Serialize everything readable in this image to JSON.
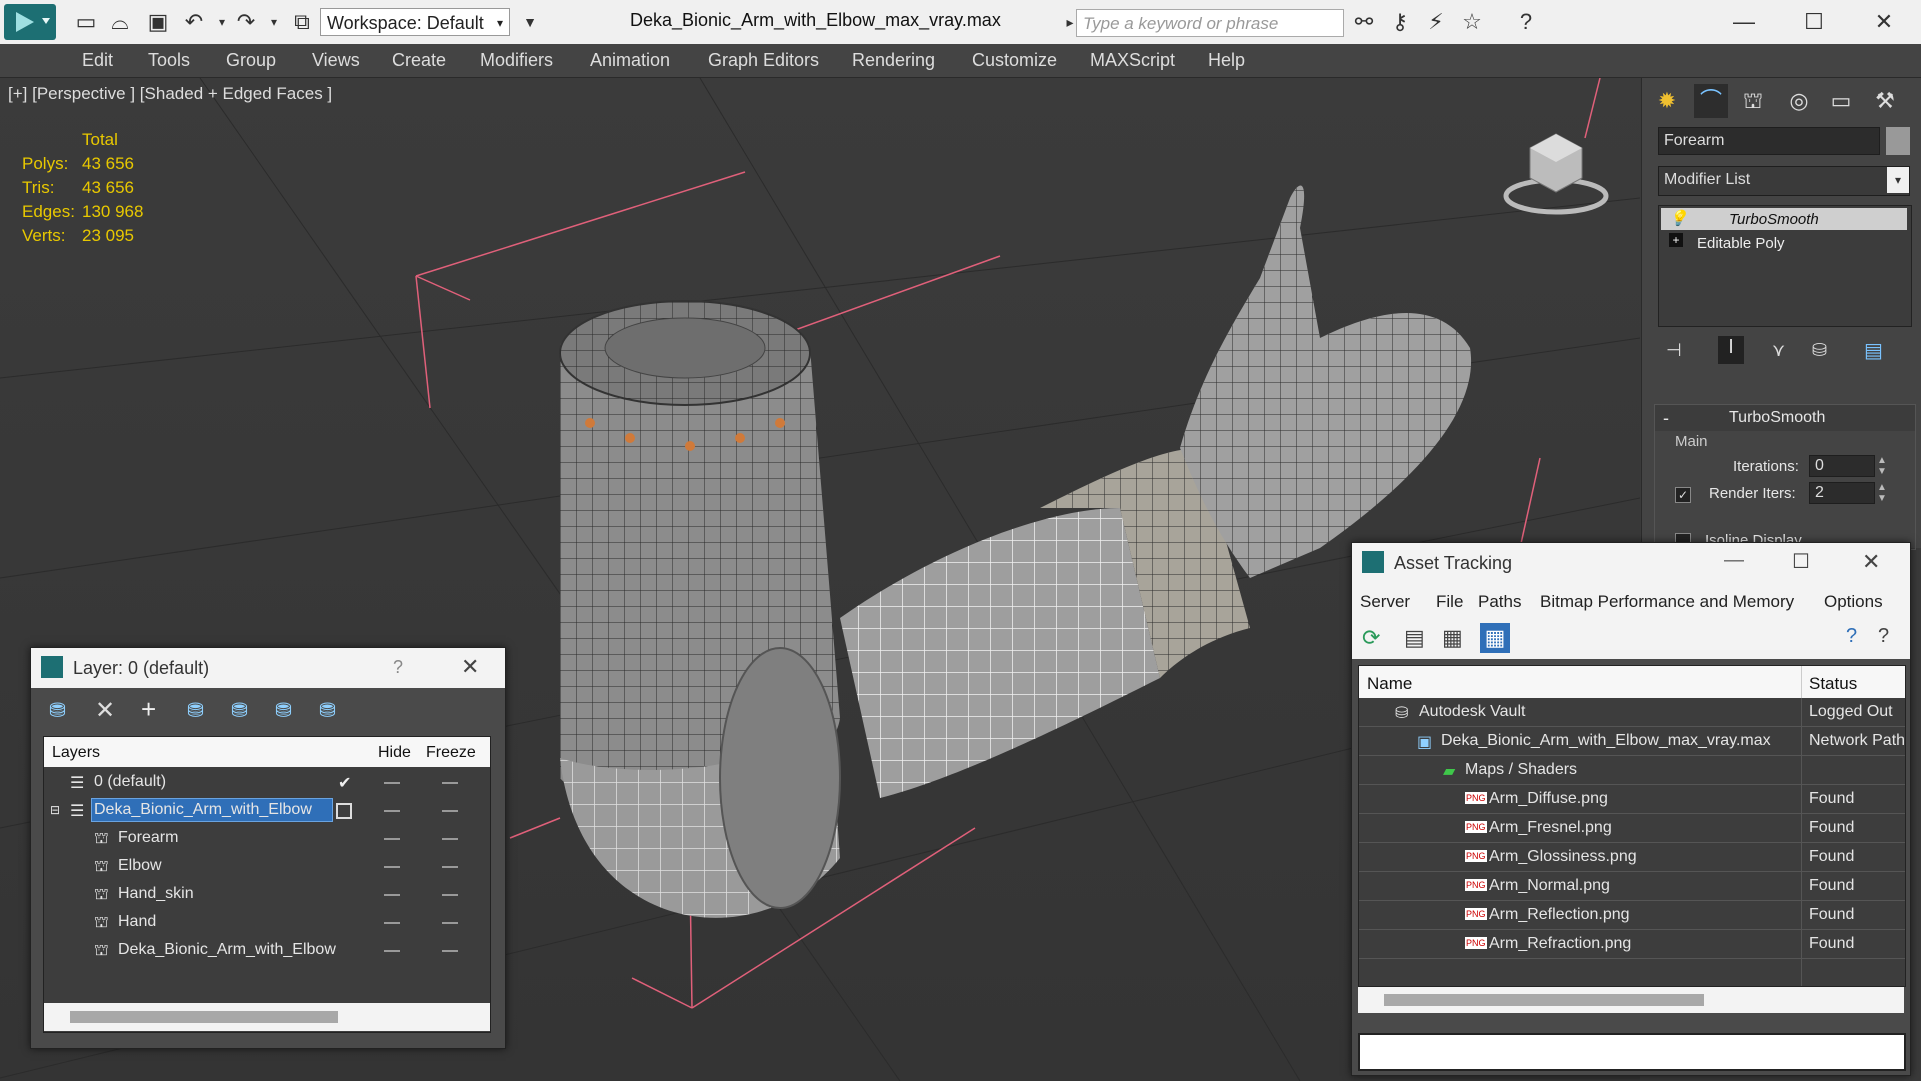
{
  "window": {
    "title": "Deka_Bionic_Arm_with_Elbow_max_vray.max",
    "workspace": "Workspace: Default",
    "search_placeholder": "Type a keyword or phrase"
  },
  "menu": [
    "Edit",
    "Tools",
    "Group",
    "Views",
    "Create",
    "Modifiers",
    "Animation",
    "Graph Editors",
    "Rendering",
    "Customize",
    "MAXScript",
    "Help"
  ],
  "viewport": {
    "label": "[+] [Perspective ] [Shaded + Edged Faces ]",
    "stats_header": "Total",
    "stats": [
      {
        "label": "Polys:",
        "value": "43 656"
      },
      {
        "label": "Tris:",
        "value": "43 656"
      },
      {
        "label": "Edges:",
        "value": "130 968"
      },
      {
        "label": "Verts:",
        "value": "23 095"
      }
    ]
  },
  "command_panel": {
    "object_name": "Forearm",
    "modifier_list": "Modifier List",
    "stack": [
      "TurboSmooth",
      "Editable Poly"
    ],
    "rollout_title": "TurboSmooth",
    "group": "Main",
    "iterations_label": "Iterations:",
    "iterations_value": "0",
    "render_iters_label": "Render Iters:",
    "render_iters_value": "2",
    "isoline_label": "Isoline Display"
  },
  "layer_dialog": {
    "title": "Layer: 0 (default)",
    "help": "?",
    "columns": {
      "layers": "Layers",
      "hide": "Hide",
      "freeze": "Freeze"
    },
    "rows": [
      {
        "name": "0 (default)",
        "level": 0
      },
      {
        "name": "Deka_Bionic_Arm_with_Elbow",
        "level": 0
      },
      {
        "name": "Forearm",
        "level": 1
      },
      {
        "name": "Elbow",
        "level": 1
      },
      {
        "name": "Hand_skin",
        "level": 1
      },
      {
        "name": "Hand",
        "level": 1
      },
      {
        "name": "Deka_Bionic_Arm_with_Elbow",
        "level": 1
      }
    ]
  },
  "asset_dialog": {
    "title": "Asset Tracking",
    "menu": [
      "Server",
      "File",
      "Paths",
      "Bitmap Performance and Memory",
      "Options"
    ],
    "columns": {
      "name": "Name",
      "status": "Status"
    },
    "rows": [
      {
        "name": "Autodesk Vault",
        "status": "Logged Out",
        "level": 0
      },
      {
        "name": "Deka_Bionic_Arm_with_Elbow_max_vray.max",
        "status": "Network Path",
        "level": 1
      },
      {
        "name": "Maps / Shaders",
        "status": "",
        "level": 2
      },
      {
        "name": "Arm_Diffuse.png",
        "status": "Found",
        "level": 3
      },
      {
        "name": "Arm_Fresnel.png",
        "status": "Found",
        "level": 3
      },
      {
        "name": "Arm_Glossiness.png",
        "status": "Found",
        "level": 3
      },
      {
        "name": "Arm_Normal.png",
        "status": "Found",
        "level": 3
      },
      {
        "name": "Arm_Reflection.png",
        "status": "Found",
        "level": 3
      },
      {
        "name": "Arm_Refraction.png",
        "status": "Found",
        "level": 3
      }
    ]
  }
}
